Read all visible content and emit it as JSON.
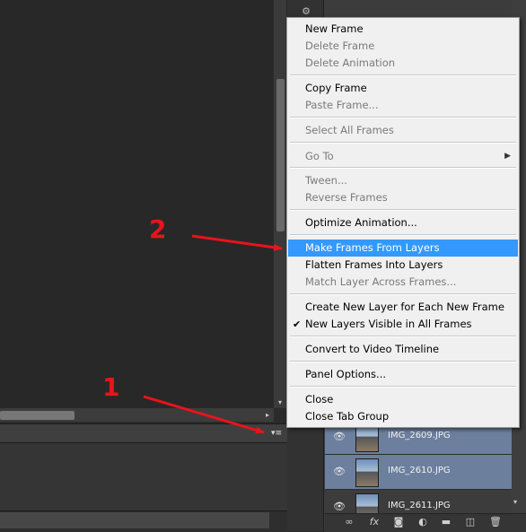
{
  "menu": {
    "items": [
      {
        "label": "New Frame",
        "enabled": true
      },
      {
        "label": "Delete Frame",
        "enabled": false
      },
      {
        "label": "Delete Animation",
        "enabled": false
      },
      {
        "label": "Copy Frame",
        "enabled": true
      },
      {
        "label": "Paste Frame...",
        "enabled": false
      },
      {
        "label": "Select All Frames",
        "enabled": false
      },
      {
        "label": "Go To",
        "enabled": false,
        "submenu": true
      },
      {
        "label": "Tween...",
        "enabled": false
      },
      {
        "label": "Reverse Frames",
        "enabled": false
      },
      {
        "label": "Optimize Animation...",
        "enabled": true
      },
      {
        "label": "Make Frames From Layers",
        "enabled": true,
        "highlighted": true
      },
      {
        "label": "Flatten Frames Into Layers",
        "enabled": true
      },
      {
        "label": "Match Layer Across Frames...",
        "enabled": false
      },
      {
        "label": "Create New Layer for Each New Frame",
        "enabled": true
      },
      {
        "label": "New Layers Visible in All Frames",
        "enabled": true,
        "checked": true
      },
      {
        "label": "Convert to Video Timeline",
        "enabled": true
      },
      {
        "label": "Panel Options...",
        "enabled": true
      },
      {
        "label": "Close",
        "enabled": true
      },
      {
        "label": "Close Tab Group",
        "enabled": true
      }
    ],
    "check_glyph": "✔",
    "submenu_glyph": "▶"
  },
  "layers": [
    {
      "name": "IMG_2609.JPG",
      "selected": true
    },
    {
      "name": "IMG_2610.JPG",
      "selected": true
    },
    {
      "name": "IMG_2611.JPG",
      "selected": false
    }
  ],
  "annotations": {
    "step1": "1",
    "step2": "2",
    "color": "#e8141b"
  },
  "icons": {
    "eye": "👁",
    "panel_menu": "▾≡",
    "scroll_down": "▾",
    "scroll_right": "▸",
    "footer": [
      "link-icon",
      "fx-icon",
      "mask-icon",
      "adjustment-icon",
      "folder-icon",
      "new-layer-icon",
      "trash-icon"
    ]
  },
  "colors": {
    "menu_highlight": "#3399ff",
    "layer_selected": "#6c7f9d",
    "panel_bg": "#3c3c3c"
  }
}
